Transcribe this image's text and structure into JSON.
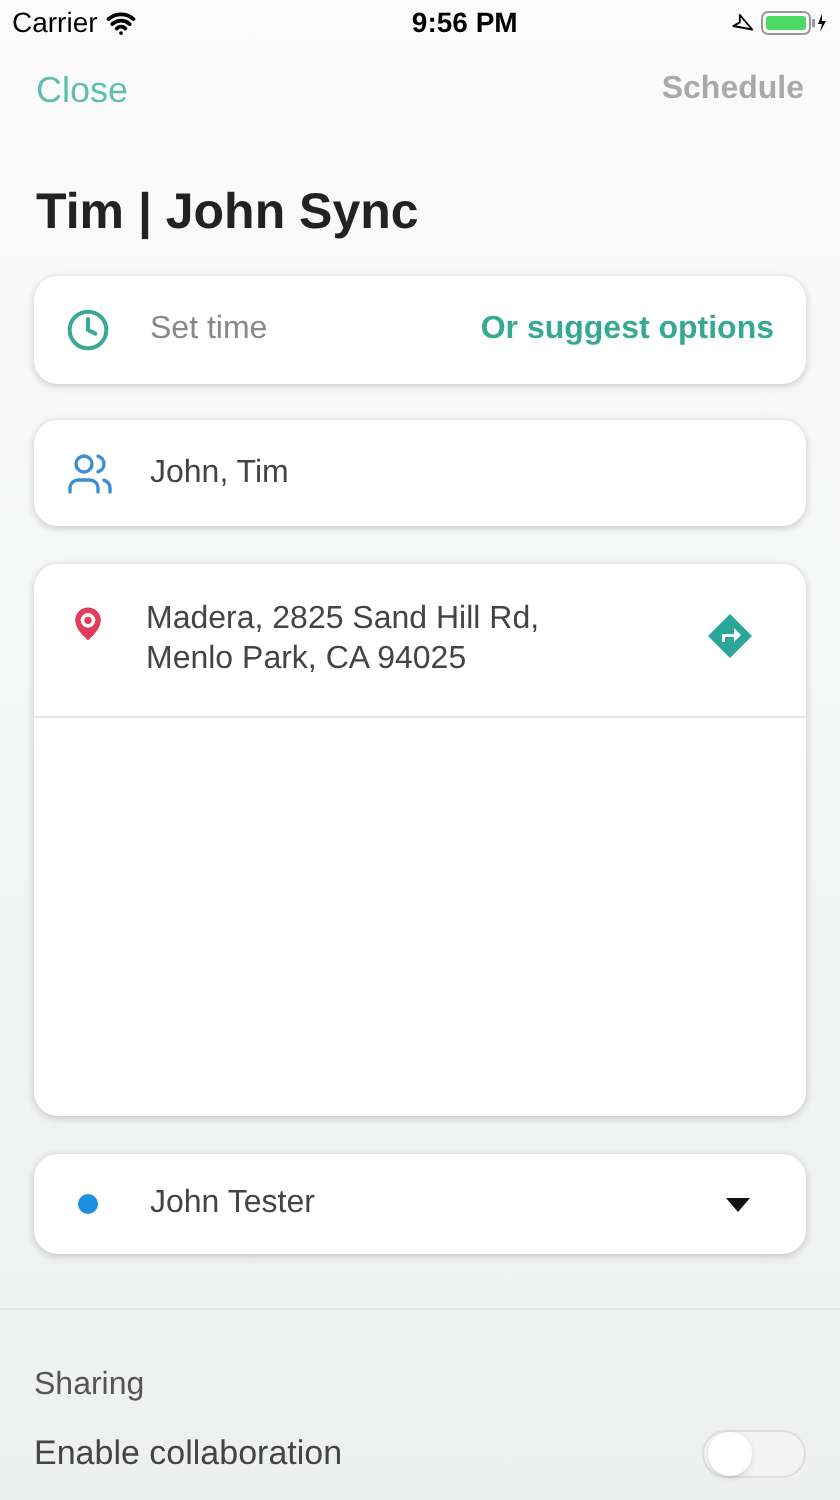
{
  "status_bar": {
    "carrier": "Carrier",
    "time": "9:56 PM"
  },
  "nav": {
    "close": "Close",
    "schedule": {
      "label": "Schedule",
      "disabled": true
    }
  },
  "title": "Tim | John Sync",
  "time_card": {
    "placeholder": "Set time",
    "action": "Or suggest options"
  },
  "attendees": "John, Tim",
  "location": {
    "address_lines": [
      "Madera, 2825 Sand Hill Rd,",
      "Menlo Park, CA 94025"
    ]
  },
  "calendar": {
    "name": "John Tester",
    "color": "#1a8fe0"
  },
  "sharing": {
    "heading": "Sharing",
    "options": [
      {
        "label": "Enable collaboration",
        "on": false
      }
    ]
  }
}
